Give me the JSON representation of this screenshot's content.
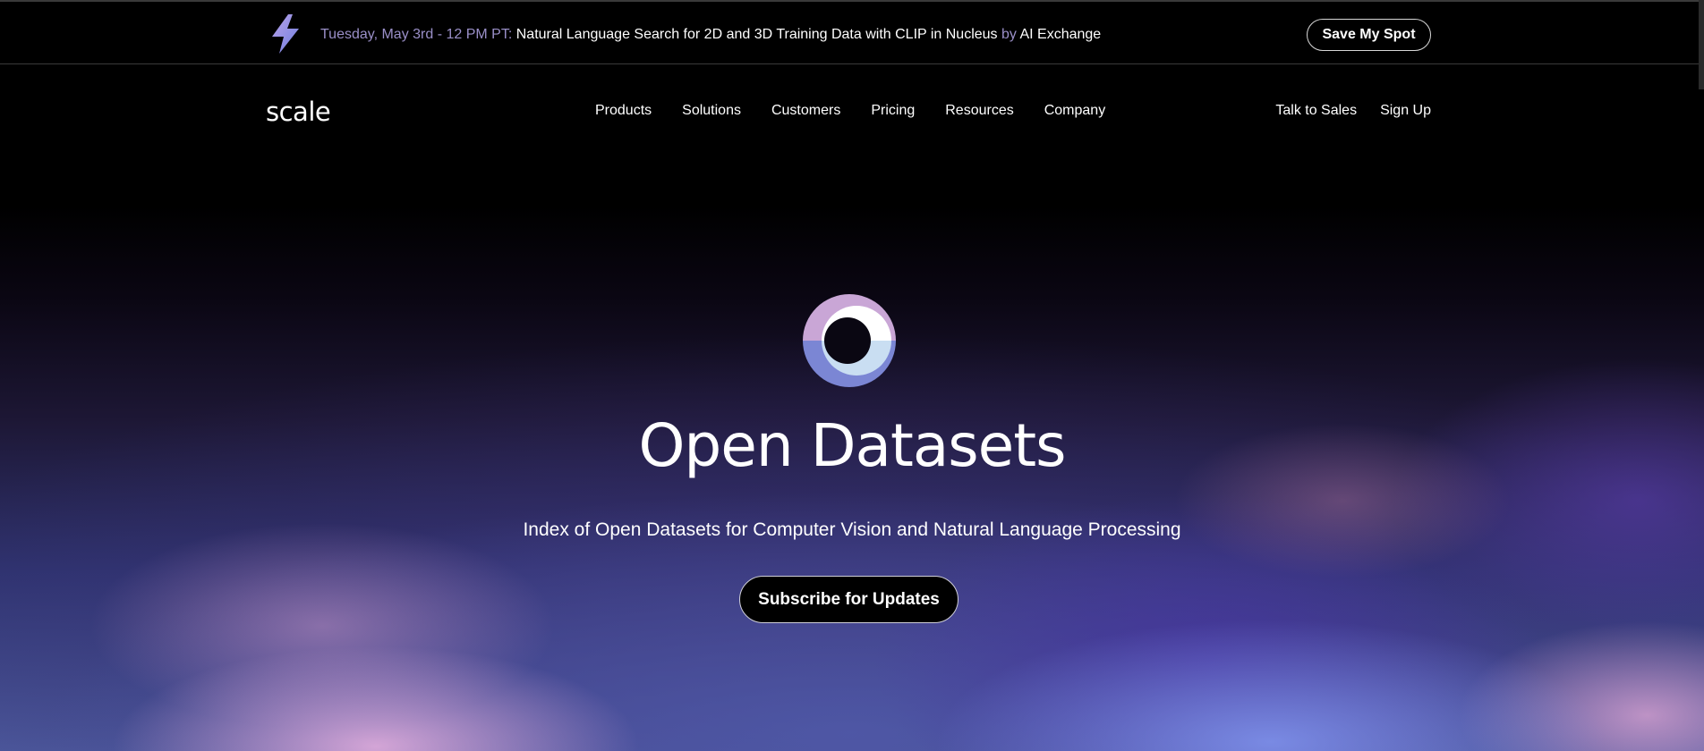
{
  "announcement": {
    "date": "Tuesday, May 3rd - 12 PM PT:",
    "title": "Natural Language Search for 2D and 3D Training Data with CLIP in Nucleus",
    "by": "by",
    "org": "AI Exchange",
    "cta": "Save My Spot",
    "icon": "lightning-bolt-icon"
  },
  "nav": {
    "logo": "scale",
    "links": [
      "Products",
      "Solutions",
      "Customers",
      "Pricing",
      "Resources",
      "Company"
    ],
    "talk_to_sales": "Talk to Sales",
    "sign_up": "Sign Up"
  },
  "hero": {
    "icon": "open-datasets-ring-icon",
    "title": "Open Datasets",
    "subtitle": "Index of Open Datasets for Computer Vision and Natural Language Processing",
    "cta": "Subscribe for Updates"
  },
  "colors": {
    "background": "#000000",
    "accent_purple": "#9a8fc8",
    "ring_pink": "#c9a6d6",
    "ring_blue": "#7b86d4",
    "ring_light": "#c9def2"
  }
}
